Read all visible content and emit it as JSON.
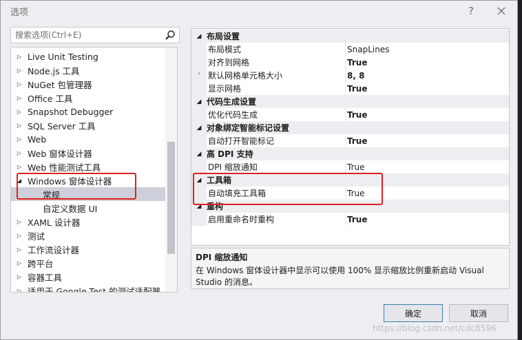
{
  "window": {
    "title": "选项",
    "help": "?",
    "close": "×"
  },
  "search": {
    "placeholder": "搜索选项(Ctrl+E)"
  },
  "tree": [
    {
      "label": "Live Unit Testing",
      "arrow": "▷"
    },
    {
      "label": "Node.js 工具",
      "arrow": "▷"
    },
    {
      "label": "NuGet 包管理器",
      "arrow": "▷"
    },
    {
      "label": "Office 工具",
      "arrow": "▷"
    },
    {
      "label": "Snapshot Debugger",
      "arrow": "▷"
    },
    {
      "label": "SQL Server 工具",
      "arrow": "▷"
    },
    {
      "label": "Web",
      "arrow": "▷"
    },
    {
      "label": "Web 窗体设计器",
      "arrow": "▷"
    },
    {
      "label": "Web 性能测试工具",
      "arrow": "▷"
    },
    {
      "label": "Windows 窗体设计器",
      "arrow": "◢"
    },
    {
      "label": "常规",
      "child": true,
      "selected": true
    },
    {
      "label": "自定义数据 UI",
      "child": true
    },
    {
      "label": "XAML 设计器",
      "arrow": "▷"
    },
    {
      "label": "测试",
      "arrow": "▷"
    },
    {
      "label": "工作流设计器",
      "arrow": "▷"
    },
    {
      "label": "跨平台",
      "arrow": "▷"
    },
    {
      "label": "容器工具",
      "arrow": "▷"
    },
    {
      "label": "适用于 Google Test 的测试适配器",
      "arrow": "▷"
    }
  ],
  "grid": [
    {
      "category": "布局设置",
      "tri": "◢"
    },
    {
      "name": "布局模式",
      "value": "SnapLines",
      "bold": false
    },
    {
      "name": "对齐到网格",
      "value": "True",
      "bold": true
    },
    {
      "name": "默认网格单元格大小",
      "value": "8, 8",
      "bold": true,
      "expander": "›"
    },
    {
      "name": "显示网格",
      "value": "True",
      "bold": true
    },
    {
      "category": "代码生成设置",
      "tri": "◢"
    },
    {
      "name": "优化代码生成",
      "value": "True",
      "bold": true
    },
    {
      "category": "对象绑定智能标记设置",
      "tri": "◢"
    },
    {
      "name": "自动打开智能标记",
      "value": "True",
      "bold": true
    },
    {
      "category": "高 DPI 支持",
      "tri": "◢"
    },
    {
      "name": "DPI 缩放通知",
      "value": "True",
      "bold": false
    },
    {
      "category": "工具箱",
      "tri": "◢"
    },
    {
      "name": "自动填充工具箱",
      "value": "True",
      "bold": false
    },
    {
      "category": "重构",
      "tri": "◢"
    },
    {
      "name": "启用重命名时重构",
      "value": "True",
      "bold": true
    }
  ],
  "description": {
    "title": "DPI 缩放通知",
    "text": "在 Windows 窗体设计器中显示可以使用 100% 显示缩放比例重新启动 Visual Studio 的消息。"
  },
  "buttons": {
    "ok": "确定",
    "cancel": "取消"
  },
  "watermark": "https://blog.csdn.net/cdc8596"
}
